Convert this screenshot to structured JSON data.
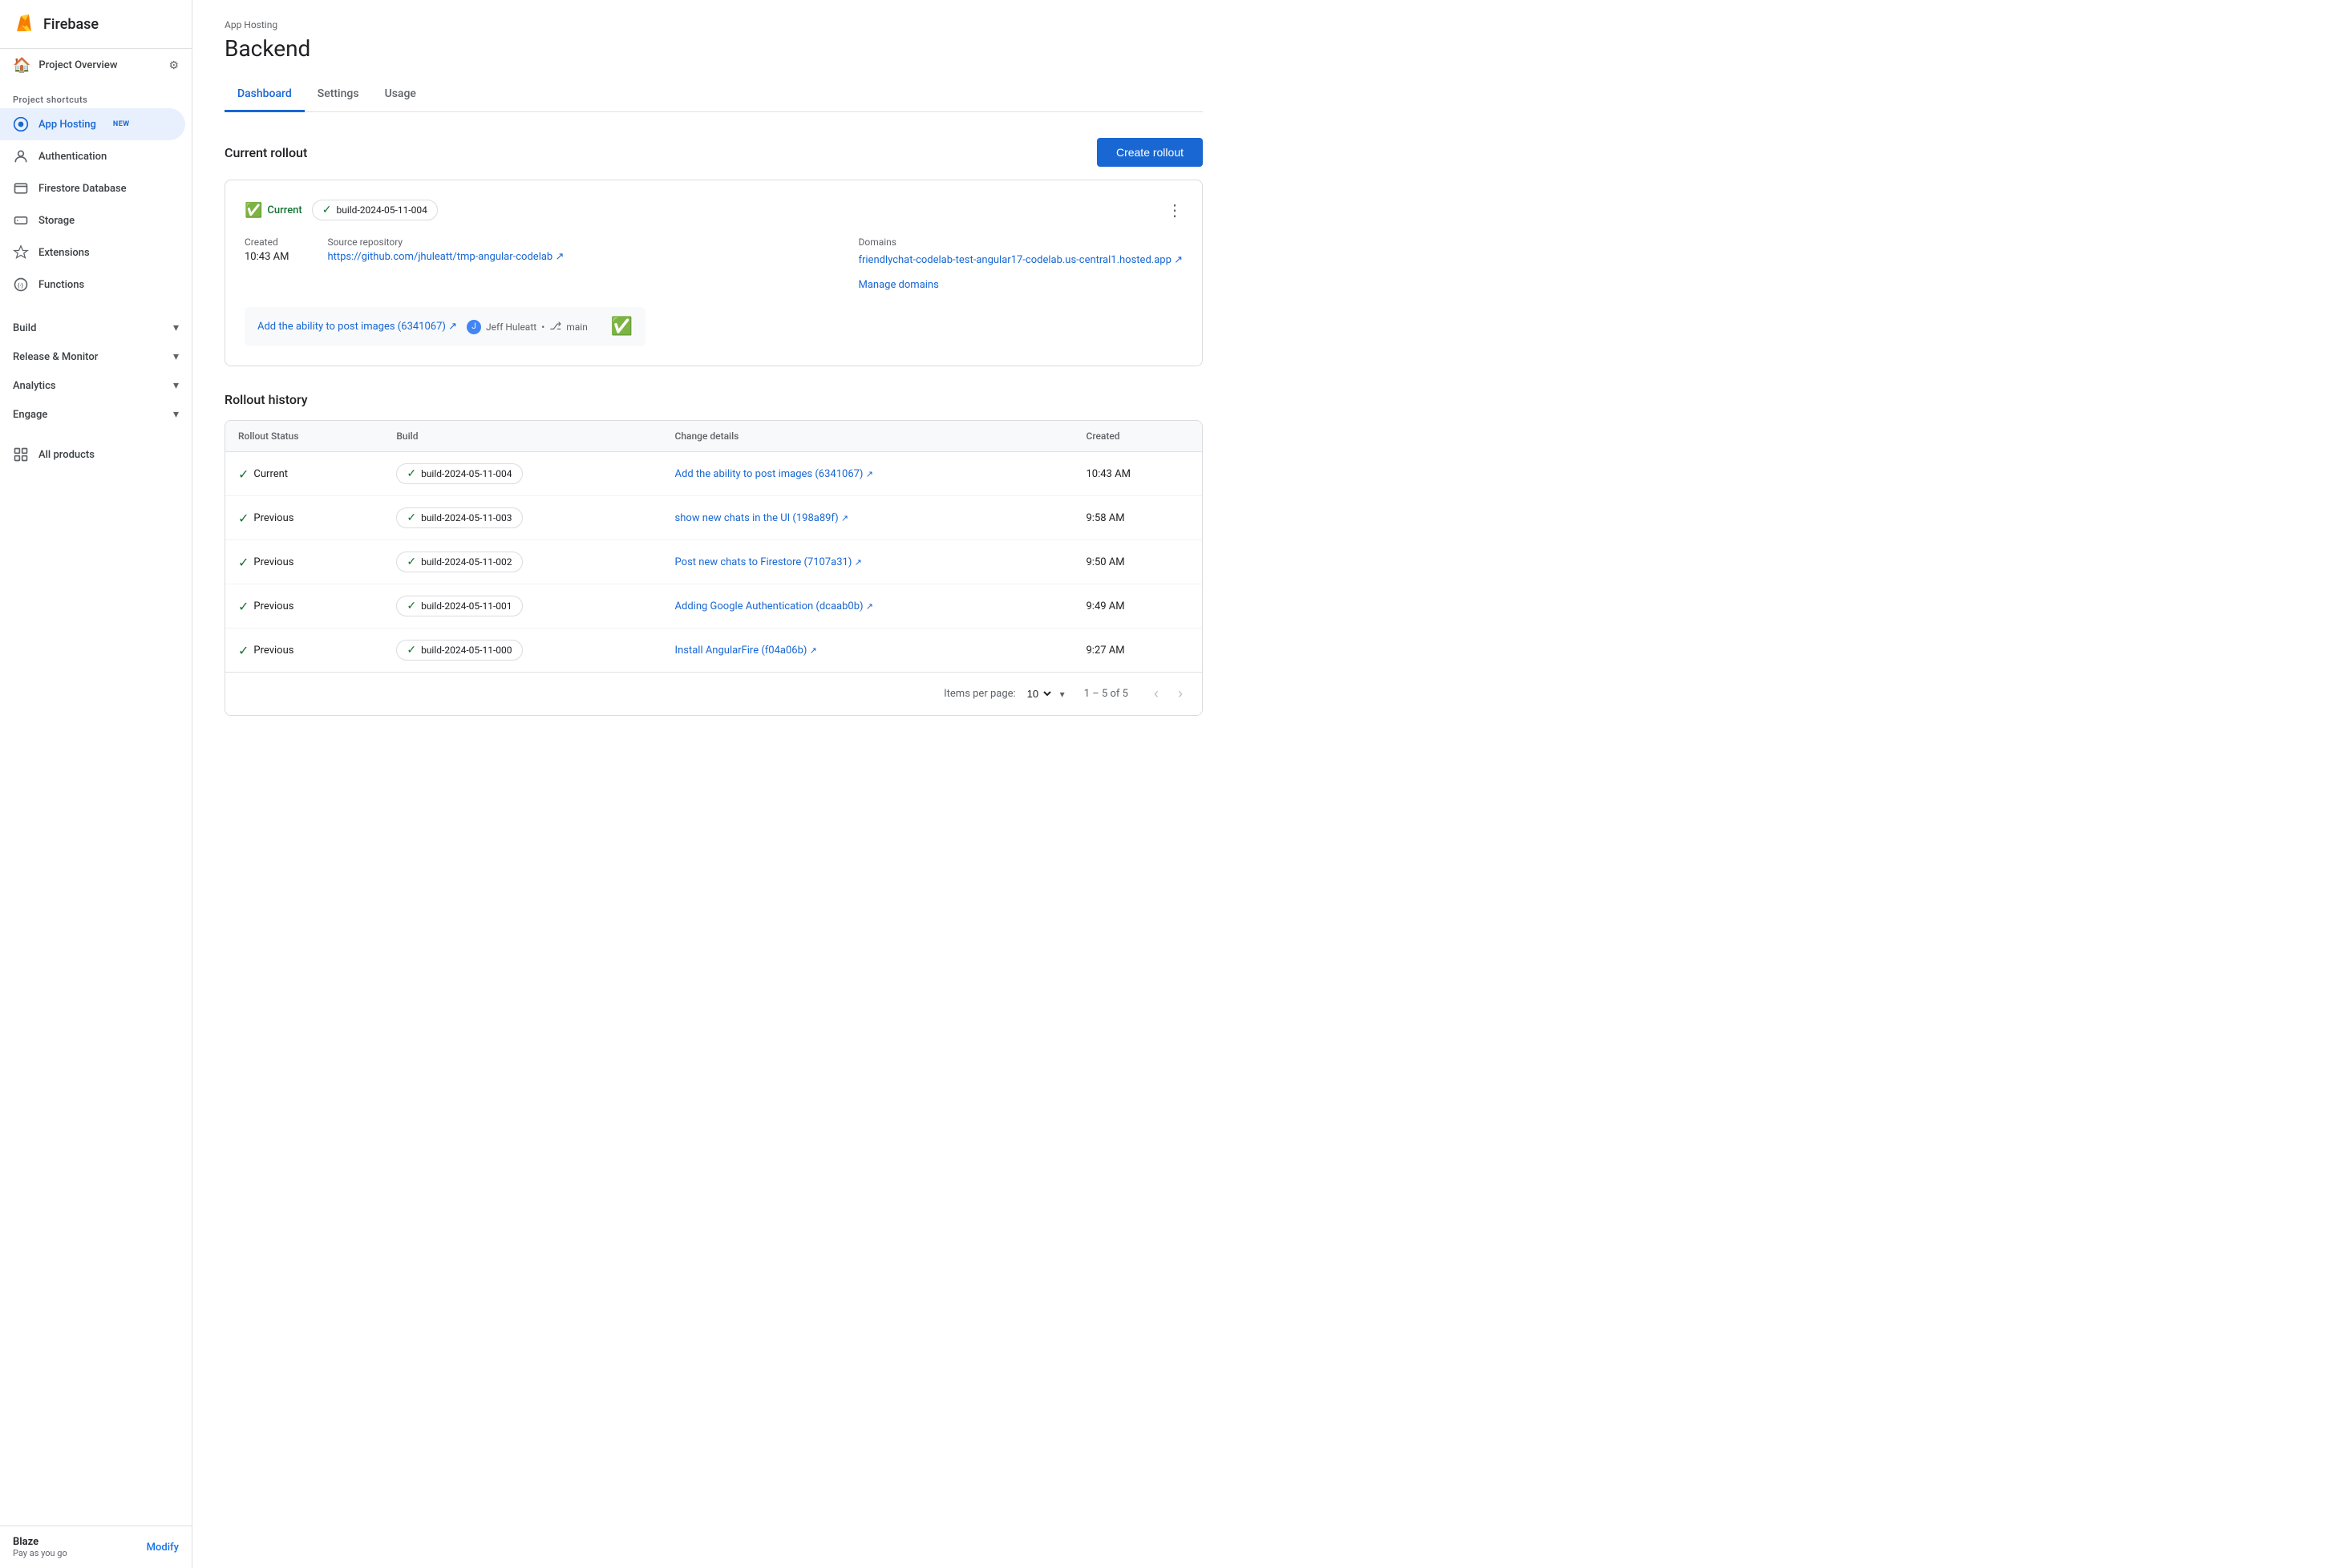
{
  "sidebar": {
    "firebase_title": "Firebase",
    "project_overview": "Project Overview",
    "project_shortcuts_label": "Project shortcuts",
    "items": [
      {
        "id": "app-hosting",
        "label": "App Hosting",
        "badge": "NEW",
        "active": true
      },
      {
        "id": "authentication",
        "label": "Authentication"
      },
      {
        "id": "firestore",
        "label": "Firestore Database"
      },
      {
        "id": "storage",
        "label": "Storage"
      },
      {
        "id": "extensions",
        "label": "Extensions"
      },
      {
        "id": "functions",
        "label": "Functions"
      }
    ],
    "categories": [
      {
        "id": "build",
        "label": "Build"
      },
      {
        "id": "release-monitor",
        "label": "Release & Monitor"
      },
      {
        "id": "analytics",
        "label": "Analytics"
      },
      {
        "id": "engage",
        "label": "Engage"
      }
    ],
    "all_products": "All products",
    "blaze_title": "Blaze",
    "blaze_sub": "Pay as you go",
    "modify_label": "Modify"
  },
  "header": {
    "breadcrumb": "App Hosting",
    "page_title": "Backend"
  },
  "tabs": [
    {
      "id": "dashboard",
      "label": "Dashboard",
      "active": true
    },
    {
      "id": "settings",
      "label": "Settings"
    },
    {
      "id": "usage",
      "label": "Usage"
    }
  ],
  "create_rollout_button": "Create rollout",
  "current_rollout": {
    "section_title": "Current rollout",
    "status": "Current",
    "build_tag": "build-2024-05-11-004",
    "created_label": "Created",
    "created_value": "10:43 AM",
    "source_repo_label": "Source repository",
    "source_repo_text": "https://github.com/jhuleatt/tmp-angular-codelab",
    "source_repo_url": "https://github.com/jhuleatt/tmp-angular-codelab",
    "domains_label": "Domains",
    "domain_url": "friendlychat-codelab-test-angular17-codelab.us-central1.hosted.app",
    "manage_domains": "Manage domains",
    "commit_message": "Add the ability to post images (6341067)",
    "commit_author": "Jeff Huleatt",
    "commit_branch": "main"
  },
  "rollout_history": {
    "section_title": "Rollout history",
    "columns": [
      {
        "id": "status",
        "label": "Rollout Status"
      },
      {
        "id": "build",
        "label": "Build"
      },
      {
        "id": "change",
        "label": "Change details"
      },
      {
        "id": "created",
        "label": "Created"
      }
    ],
    "rows": [
      {
        "status": "Current",
        "build": "build-2024-05-11-004",
        "change_text": "Add the ability to post images (6341067)",
        "change_url": "#",
        "created": "10:43 AM"
      },
      {
        "status": "Previous",
        "build": "build-2024-05-11-003",
        "change_text": "show new chats in the UI (198a89f)",
        "change_url": "#",
        "created": "9:58 AM"
      },
      {
        "status": "Previous",
        "build": "build-2024-05-11-002",
        "change_text": "Post new chats to Firestore (7107a31)",
        "change_url": "#",
        "created": "9:50 AM"
      },
      {
        "status": "Previous",
        "build": "build-2024-05-11-001",
        "change_text": "Adding Google Authentication (dcaab0b)",
        "change_url": "#",
        "created": "9:49 AM"
      },
      {
        "status": "Previous",
        "build": "build-2024-05-11-000",
        "change_text": "Install AngularFire (f04a06b)",
        "change_url": "#",
        "created": "9:27 AM"
      }
    ],
    "pagination": {
      "items_per_page_label": "Items per page:",
      "per_page_value": "10",
      "page_info": "1 – 5 of 5"
    }
  }
}
